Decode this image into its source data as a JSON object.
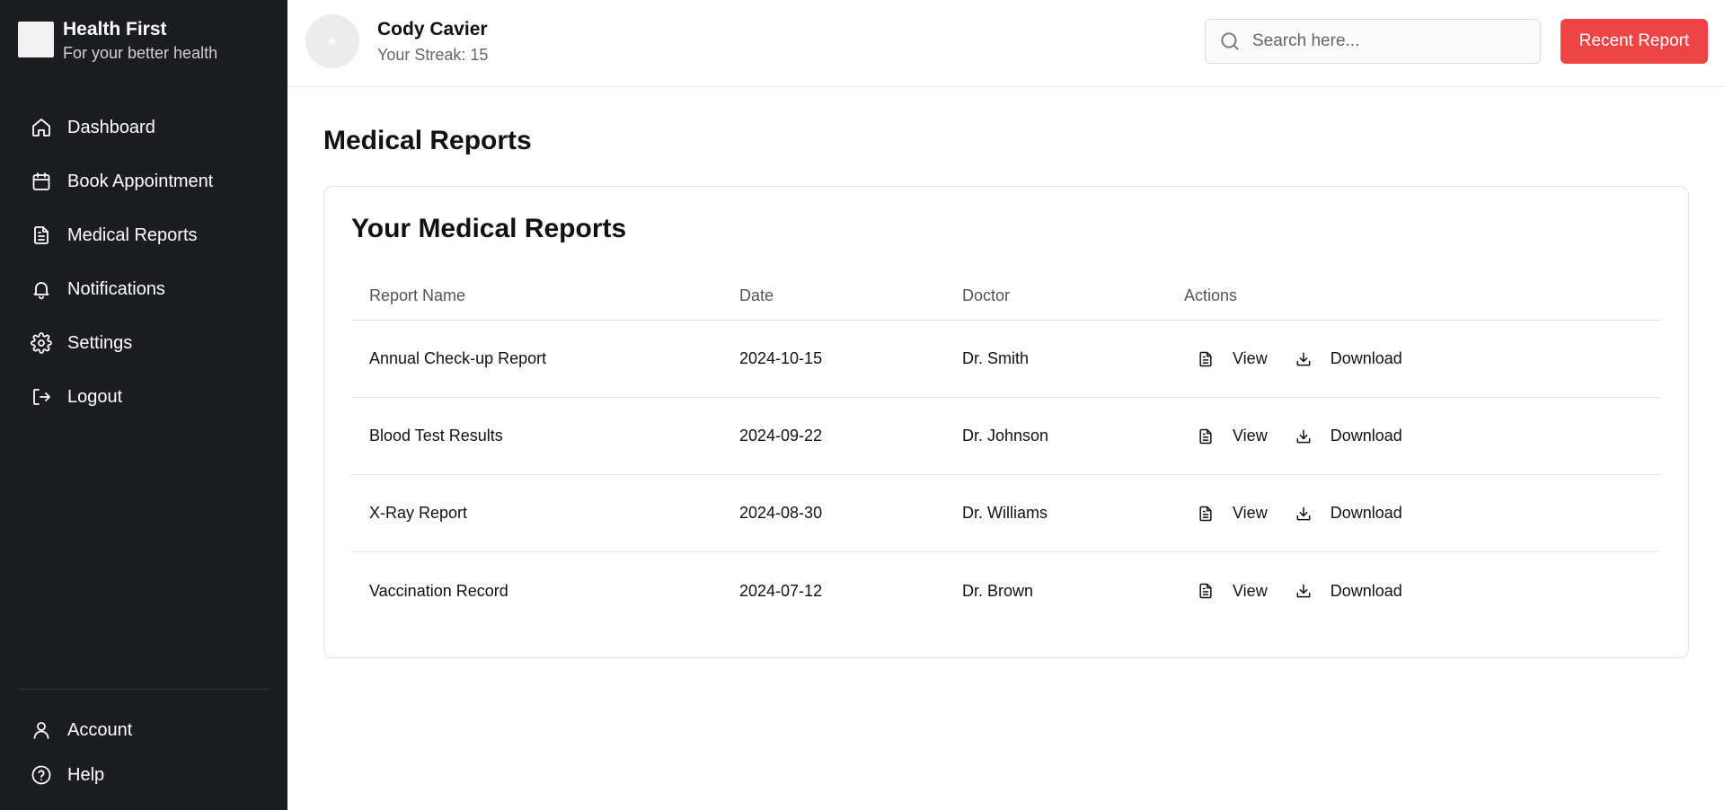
{
  "app": {
    "name": "Health First",
    "tagline": "For your better health"
  },
  "sidebar": {
    "items": [
      {
        "label": "Dashboard",
        "icon": "home-icon"
      },
      {
        "label": "Book Appointment",
        "icon": "calendar-icon"
      },
      {
        "label": "Medical Reports",
        "icon": "file-text-icon"
      },
      {
        "label": "Notifications",
        "icon": "bell-icon"
      },
      {
        "label": "Settings",
        "icon": "gear-icon"
      },
      {
        "label": "Logout",
        "icon": "logout-icon"
      }
    ],
    "bottom_items": [
      {
        "label": "Account",
        "icon": "user-icon"
      },
      {
        "label": "Help",
        "icon": "help-circle-icon"
      }
    ]
  },
  "header": {
    "user_name": "Cody Cavier",
    "streak": "Your Streak: 15",
    "search_placeholder": "Search here...",
    "recent_button": "Recent Report"
  },
  "main": {
    "page_title": "Medical Reports",
    "card_title": "Your Medical Reports",
    "columns": [
      "Report Name",
      "Date",
      "Doctor",
      "Actions"
    ],
    "rows": [
      {
        "name": "Annual Check-up Report",
        "date": "2024-10-15",
        "doctor": "Dr. Smith"
      },
      {
        "name": "Blood Test Results",
        "date": "2024-09-22",
        "doctor": "Dr. Johnson"
      },
      {
        "name": "X-Ray Report",
        "date": "2024-08-30",
        "doctor": "Dr. Williams"
      },
      {
        "name": "Vaccination Record",
        "date": "2024-07-12",
        "doctor": "Dr. Brown"
      }
    ],
    "actions": {
      "view": "View",
      "download": "Download"
    }
  },
  "colors": {
    "sidebar_bg": "#1c1d21",
    "accent": "#ef4444"
  }
}
